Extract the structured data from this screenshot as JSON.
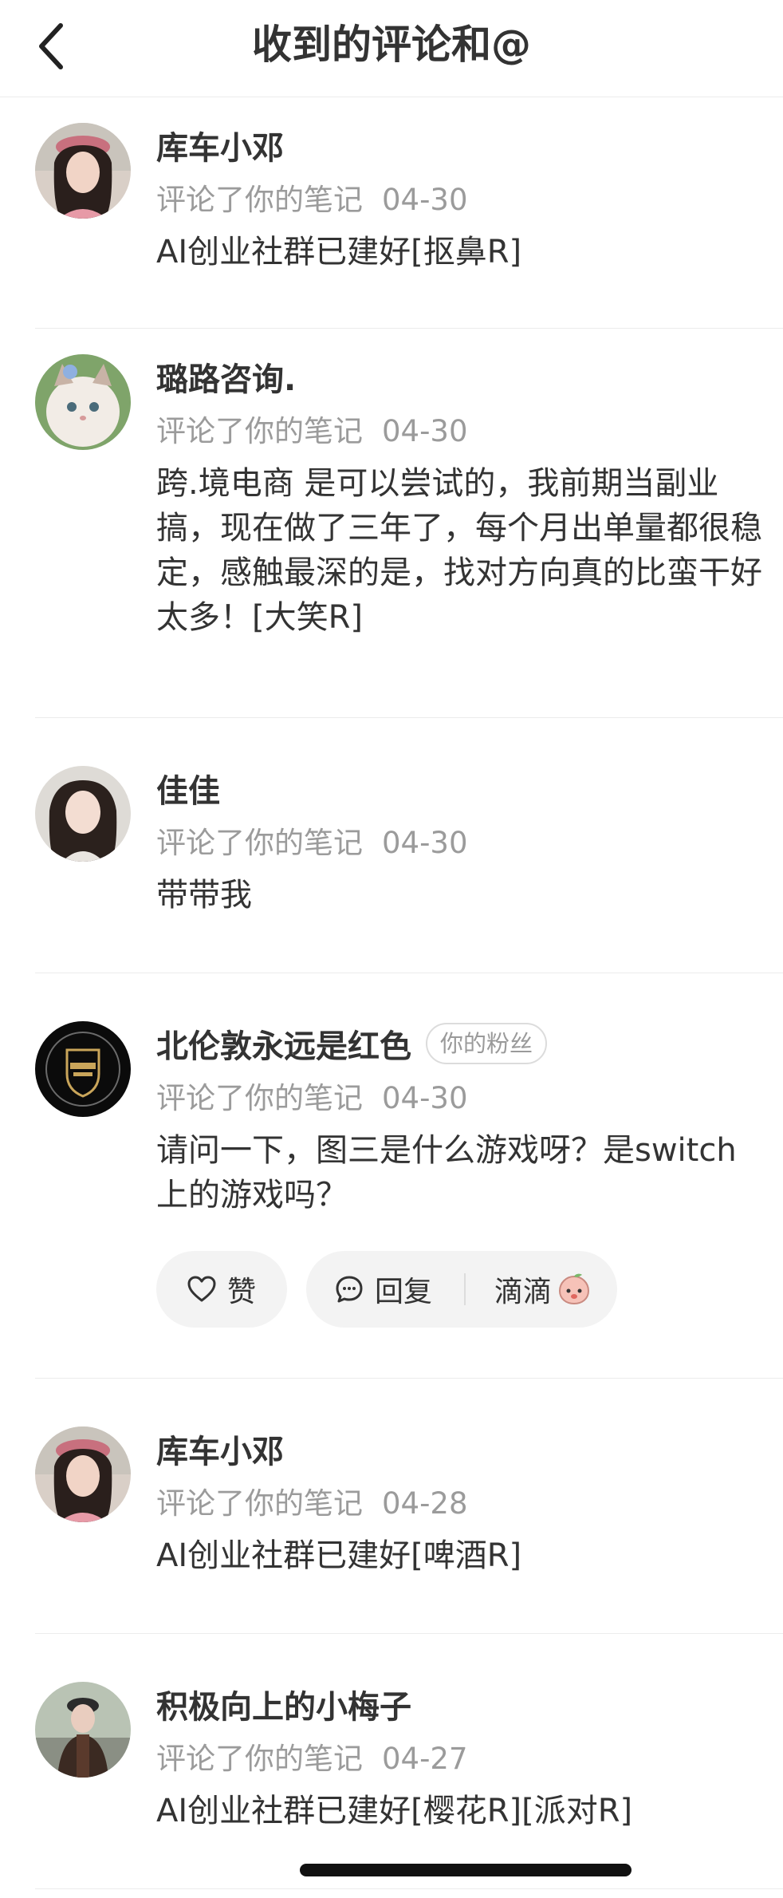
{
  "header": {
    "title": "收到的评论和@"
  },
  "comments": [
    {
      "name": "库车小邓",
      "action": "评论了你的笔记",
      "date": "04-30",
      "text": "AI创业社群已建好[抠鼻R]",
      "avatar": "woman-portrait"
    },
    {
      "name": "璐路咨询.",
      "action": "评论了你的笔记",
      "date": "04-30",
      "text": "跨.境电商 是可以尝试的，我前期当副业搞，现在做了三年了，每个月出单量都很稳定，感触最深的是，找对方向真的比蛮干好太多！[大笑R]",
      "avatar": "kitten"
    },
    {
      "name": "佳佳",
      "action": "评论了你的笔记",
      "date": "04-30",
      "text": "带带我",
      "avatar": "woman-portrait"
    },
    {
      "name": "北伦敦永远是红色",
      "badge": "你的粉丝",
      "action": "评论了你的笔记",
      "date": "04-30",
      "text": "请问一下，图三是什么游戏呀？是switch上的游戏吗？",
      "avatar": "arsenal-crest",
      "actions": {
        "like_label": "赞",
        "reply_label": "回复",
        "emoji_label": "滴滴"
      }
    },
    {
      "name": "库车小邓",
      "action": "评论了你的笔记",
      "date": "04-28",
      "text": "AI创业社群已建好[啤酒R]",
      "avatar": "woman-portrait"
    },
    {
      "name": "积极向上的小梅子",
      "action": "评论了你的笔记",
      "date": "04-27",
      "text": "AI创业社群已建好[樱花R][派对R]",
      "avatar": "woman-outdoor"
    }
  ]
}
